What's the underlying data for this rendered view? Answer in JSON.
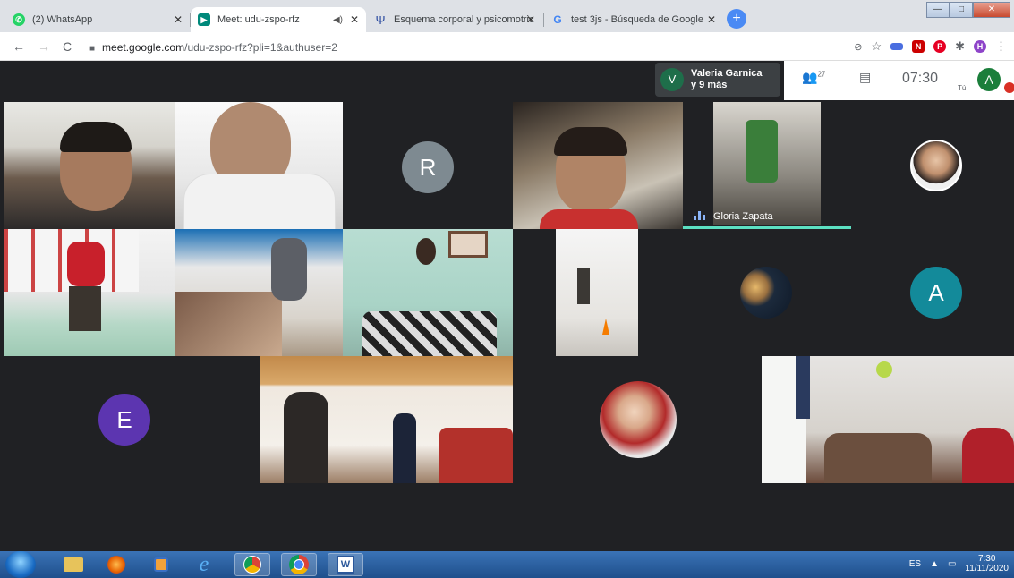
{
  "browser": {
    "tabs": [
      {
        "label": "(2) WhatsApp",
        "icon": "whatsapp-icon"
      },
      {
        "label": "Meet: udu-zspo-rfz",
        "icon": "google-meet-icon"
      },
      {
        "label": "Esquema corporal y psicomotric",
        "icon": "psi-icon"
      },
      {
        "label": "test 3js - Búsqueda de Google",
        "icon": "google-icon"
      }
    ],
    "url_host": "meet.google.com",
    "url_path": "/udu-zspo-rfz?pli=1&authuser=2"
  },
  "meet": {
    "presenter_initial": "V",
    "presenter_name": "Valeria Garnica",
    "presenter_more": "y 9 más",
    "participants_count": "27",
    "time": "07:30",
    "self_label": "Tú",
    "self_initial": "A",
    "tiles": {
      "r_initial": "R",
      "a_initial": "A",
      "e_initial": "E",
      "gloria_name": "Gloria Zapata"
    }
  },
  "taskbar": {
    "lang": "ES",
    "time": "7:30",
    "date": "11/11/2020"
  },
  "colors": {
    "meet_bg": "#202124",
    "avatar_r": "#7e8a91",
    "avatar_a": "#138a9a",
    "avatar_e": "#5c35b0"
  }
}
